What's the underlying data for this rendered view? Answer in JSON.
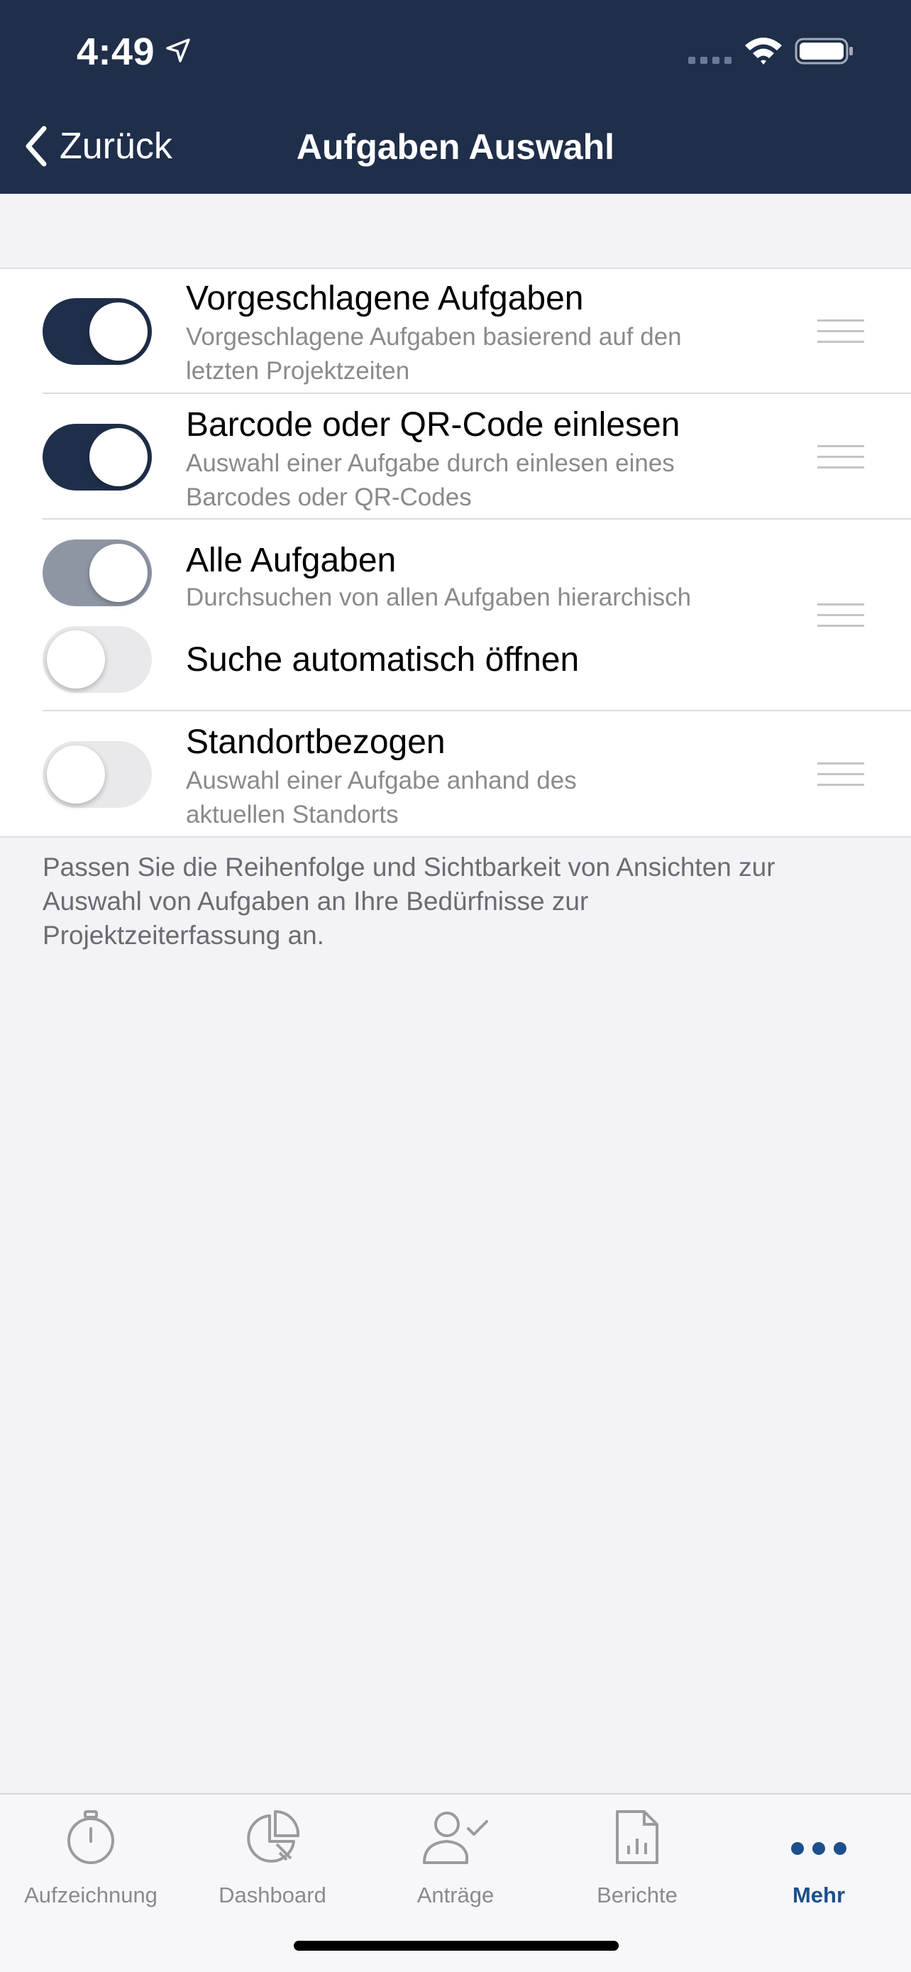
{
  "status_bar": {
    "time": "4:49"
  },
  "nav": {
    "back_label": "Zurück",
    "title": "Aufgaben Auswahl"
  },
  "rows": [
    {
      "title": "Vorgeschlagene Aufgaben",
      "subtitle_line1": "Vorgeschlagene Aufgaben basierend auf den",
      "subtitle_line2": "letzten Projektzeiten",
      "toggle": "on"
    },
    {
      "title": "Barcode oder QR-Code einlesen",
      "subtitle_line1": "Auswahl einer Aufgabe durch einlesen eines",
      "subtitle_line2": "Barcodes oder QR-Codes",
      "toggle": "on"
    },
    {
      "title": "Alle Aufgaben",
      "subtitle_line1": "Durchsuchen von allen Aufgaben hierarchisch",
      "toggle": "on-dimmed",
      "sub_option": {
        "title": "Suche automatisch öffnen",
        "toggle": "off"
      }
    },
    {
      "title": "Standortbezogen",
      "subtitle_line1": "Auswahl einer Aufgabe anhand des",
      "subtitle_line2": "aktuellen Standorts",
      "toggle": "off"
    }
  ],
  "footer_note": {
    "line1": "Passen Sie die Reihenfolge und Sichtbarkeit von Ansichten zur",
    "line2": "Auswahl von Aufgaben an Ihre Bedürfnisse zur",
    "line3": "Projektzeiterfassung an."
  },
  "tabs": [
    {
      "label": "Aufzeichnung",
      "icon": "stopwatch-icon"
    },
    {
      "label": "Dashboard",
      "icon": "pie-chart-icon"
    },
    {
      "label": "Anträge",
      "icon": "user-check-icon"
    },
    {
      "label": "Berichte",
      "icon": "report-icon"
    },
    {
      "label": "Mehr",
      "icon": "more-dots-icon",
      "active": true
    }
  ],
  "colors": {
    "header": "#1f2f4a",
    "toggle_on": "#1f2f4a",
    "toggle_dimmed": "#8e96a4",
    "active_tab": "#1d4f8c"
  }
}
